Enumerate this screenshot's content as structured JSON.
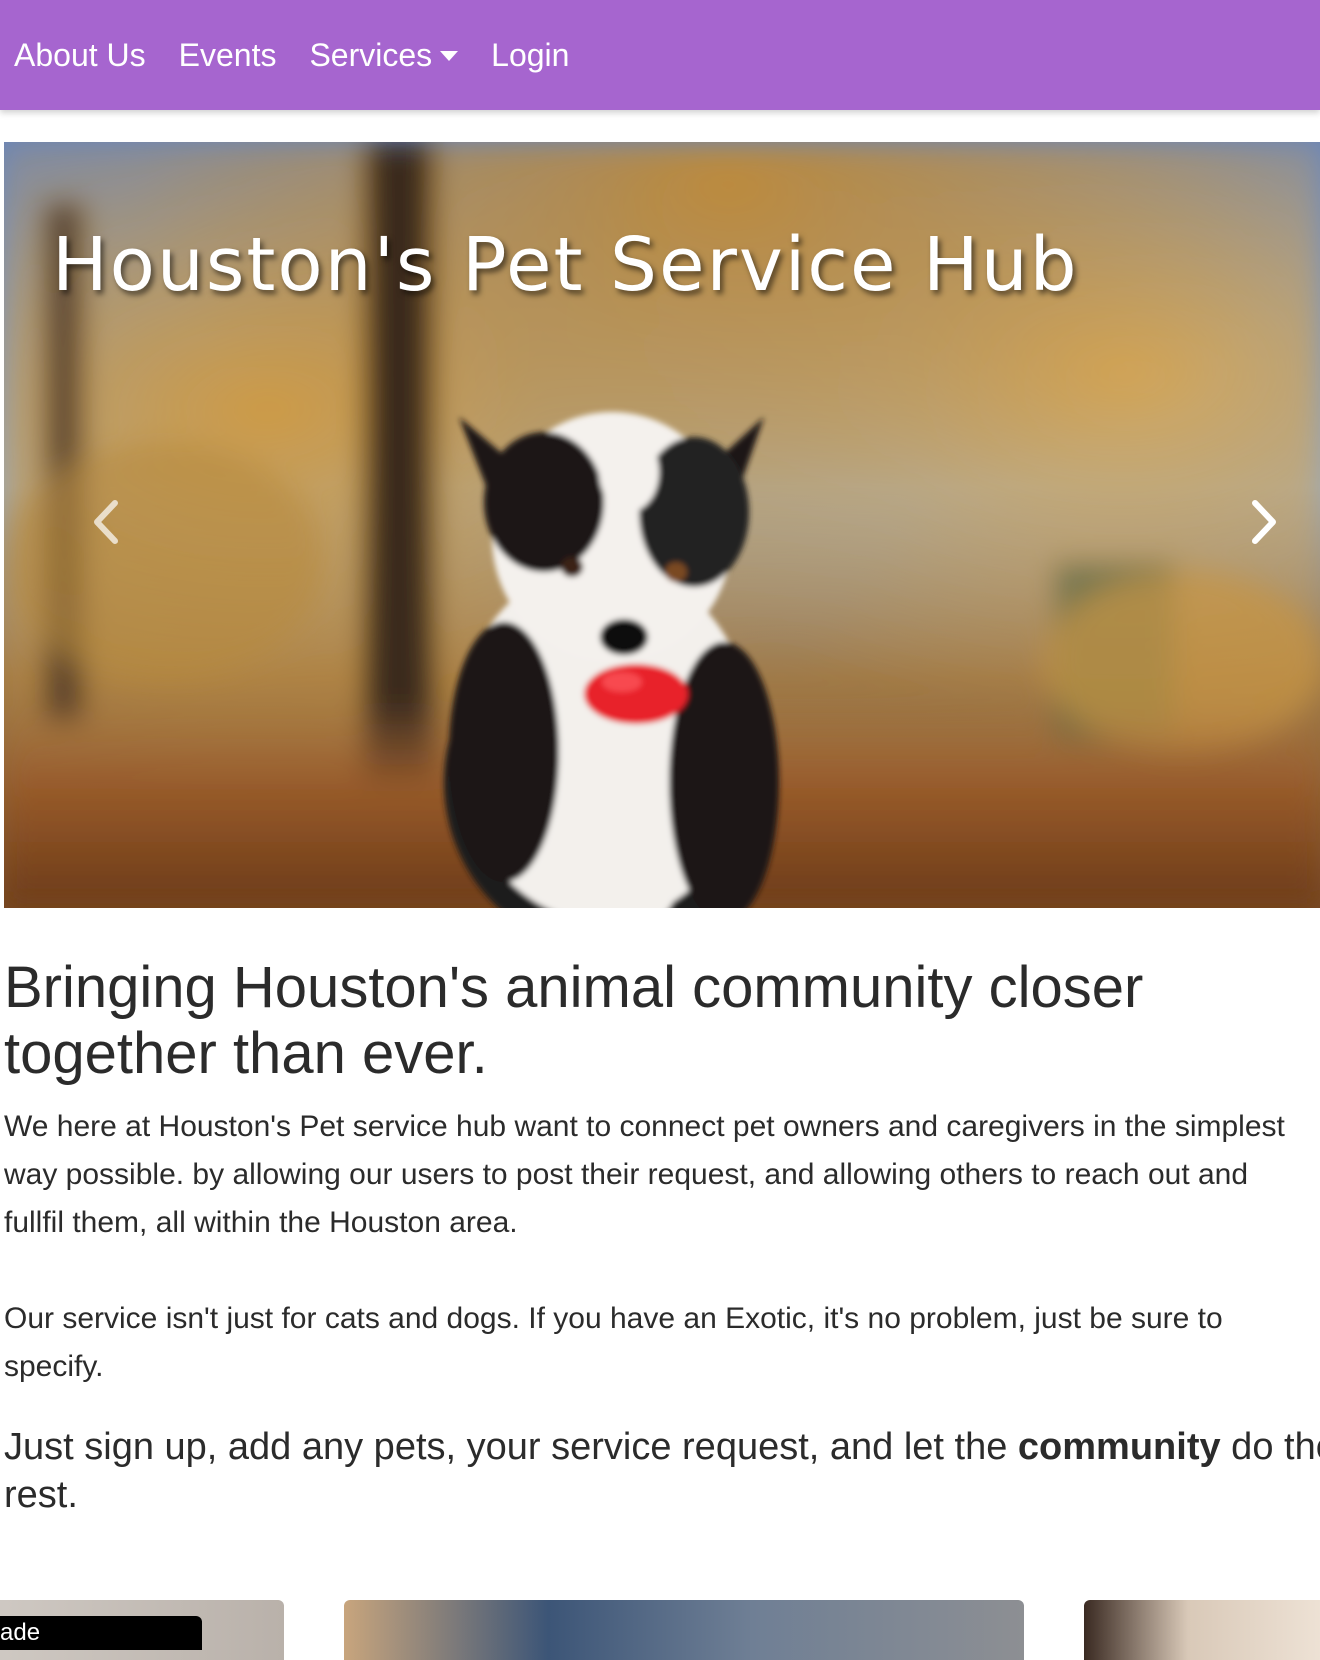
{
  "nav": {
    "items": [
      {
        "label": "About Us"
      },
      {
        "label": "Events"
      },
      {
        "label": "Services"
      },
      {
        "label": "Login"
      }
    ],
    "background": "#a665cf"
  },
  "hero": {
    "title": "Houston's Pet Service Hub",
    "prev_icon": "chevron-left-icon",
    "next_icon": "chevron-right-icon"
  },
  "main": {
    "headline": "Bringing Houston's animal community closer together than ever.",
    "para1_line1": "We here at Houston's Pet service hub want to connect pet owners and caregivers in the simplest",
    "para1_line2": "way possible. by allowing our users to post their request, and allowing others to reach out and",
    "para1_line3": "fullfil them, all within the Houston area.",
    "para2_line1": "Our service isn't just for cats and dogs. If you have an Exotic, it's no problem, just be sure to",
    "para2_line2": "specify.",
    "para3_before": "Just sign up, add any pets, your service request, and let the ",
    "para3_bold": "community",
    "para3_after": " do the",
    "para3_line2": "rest."
  },
  "cards": {
    "badge_text": "ade"
  }
}
